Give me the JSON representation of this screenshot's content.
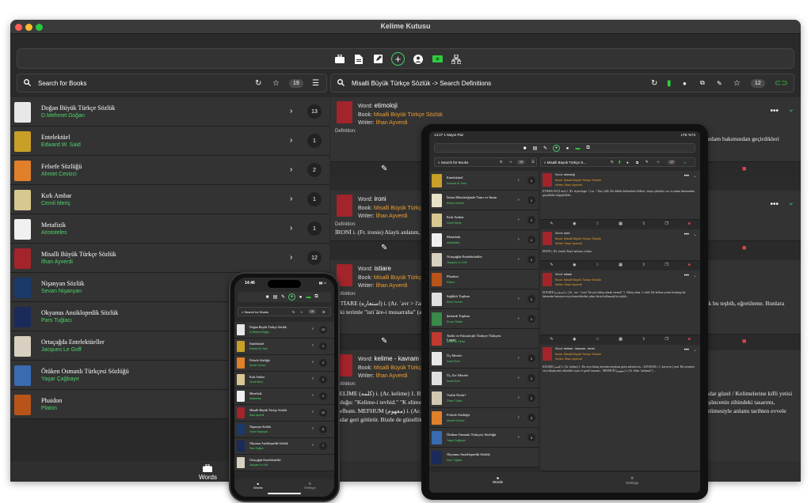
{
  "window": {
    "title": "Kelime Kutusu"
  },
  "left_search": {
    "placeholder": "Search for Books",
    "count": "19"
  },
  "right_search": {
    "query": "Misalli Büyük Türkçe Sözlük -> Search Definitions",
    "count": "12"
  },
  "books": [
    {
      "title": "Doğan Büyük Türkçe Sözlük",
      "author": "D.Mehmet Doğan",
      "count": "13",
      "color": "#e8e8e8"
    },
    {
      "title": "Entelektüel",
      "author": "Edward W. Said",
      "count": "1",
      "color": "#c8a028"
    },
    {
      "title": "Felsefe Sözlüğü",
      "author": "Ahmet Cevizci",
      "count": "2",
      "color": "#e0802a"
    },
    {
      "title": "Kırk Ambar",
      "author": "Cemil Meriç",
      "count": "1",
      "color": "#d8c890"
    },
    {
      "title": "Metafizik",
      "author": "Aristoteles",
      "count": "1",
      "color": "#f0f0f0"
    },
    {
      "title": "Misalli Büyük Türkçe Sözlük",
      "author": "İlhan Ayverdi",
      "count": "12",
      "color": "#a3242b"
    },
    {
      "title": "Nişanyan Sözlük",
      "author": "Sevan Nişanyan",
      "count": "",
      "color": "#1a3a6a"
    },
    {
      "title": "Okyanus Ansiklopedik Sözlük",
      "author": "Pars Tuğlacı",
      "count": "",
      "color": "#1a2a5a"
    },
    {
      "title": "Ortaçağda Entelektüeller",
      "author": "Jacques Le Goff",
      "count": "",
      "color": "#d8d0c0"
    },
    {
      "title": "Ötüken Osmanlı Türkçesi Sözlüğü",
      "author": "Yaşar Çağbayır",
      "count": "",
      "color": "#3a6ab0"
    },
    {
      "title": "Phaidon",
      "author": "Platon",
      "count": "",
      "color": "#b8541a"
    }
  ],
  "words": [
    {
      "word": "etimoloji",
      "book": "Misalli Büyük Türkçe Sözlük",
      "writer": "İlhan Ayverdi",
      "def_label": "Definition:",
      "text": "ETİMOLOJİ [İ ince] i. (Fr. etymologie < Lat. < Yun.) dilb. Bir dildeki kelimelerin kökleri, ortaya çıktıkları, ses ve anlam bakımından geçirdikleri değişikliklerini..."
    },
    {
      "word": "ironi",
      "book": "Misalli Büyük Türkçe Sözlük",
      "writer": "İlhan Ayverdi",
      "def_label": "Definition:",
      "text": "İRONİ i. (Fr. ironie) Alaylı anlatım, istihza."
    },
    {
      "word": "istiare",
      "book": "Misalli Büyük Türkçe Sözlük",
      "writer": "İlhan Ayverdi",
      "def_label": "Definition:",
      "text": "İSTİARE (استعاره) i. (Ar. ʿavr > i'are) 1. Ödünç alma. 2. edeb. Bir kelime yerine herhangi bir bakımdan benzeyen veya benzetilenden yalnız birini kullanarak bu teşbih, eğretileme. Bunlara eski terimle \"istiʿâre-i musarraha\" (açık istiare) denir."
    },
    {
      "word": "kelime - kavram - terim",
      "book": "Misalli Büyük Türkçe Sözlük",
      "writer": "İlhan Ayverdi",
      "def_label": "Definition:",
      "text": "KELİME (كلمه) i. (Ar. kelime) 1. Bir ses birliği veya bir kelime bile konuşamıyoruz (Reşat Nuri Güntekin). Kelimeler üzerinde düşünme bir şarkıların bu kadar güzel / Kelimelerine kifli yetisi olduğu: \"Kelime-i tevhid.\" \"K elime-i tayyibe.\" \"K elime-i şehadet.\" \"Tek kelimeyle: Sabır ve sebatla.\" KAVRAM i. (< kavra-m ) yeni. Bir nesnenin veya düşüncenin zihindeki tasarımı, mefhum. MEFHUM (مفهوم) i. (Ar. fehm \"anlamak\") Mefhum anlamları tarihten evvele kadar geri götürmek lazımdır (Refik H. Karay). Kavram, tasavvur kelimesiyle anlamı tarihten evvele kadar geri götürür. Bizde de güzellik mefhumu ... \"Devlet mefhumu.\" \"Adalet mefhumu.\""
    }
  ],
  "labels": {
    "book": "Book:",
    "writer": "Writer:",
    "word": "Word:"
  },
  "tabs": {
    "words": "Words",
    "settings": "Settings"
  },
  "ipad": {
    "status_left": "14:27  1 Mayıs Paz",
    "status_right": "LTE %74",
    "search_left": "Search for Books",
    "search_right": "Misalli Büyük Türkçe S...",
    "left_count": "19",
    "right_count": "12",
    "books": [
      {
        "title": "Entelektüel",
        "author": "Edward W. Said",
        "count": "1",
        "color": "#c8a028"
      },
      {
        "title": "İslam Metafiziğinde Tanrı ve İnsan",
        "author": "Ekrem Demirli",
        "count": "1",
        "color": "#e8e0c8"
      },
      {
        "title": "Kırk Ambar",
        "author": "Cemil Meriç",
        "count": "1",
        "color": "#d8c890"
      },
      {
        "title": "Metafizik",
        "author": "Aristoteles",
        "count": "1",
        "color": "#f0f0f0"
      },
      {
        "title": "Ortaçağda Entelektüeller",
        "author": "Jacques Le Goff",
        "count": "1",
        "color": "#d8d0c0"
      },
      {
        "title": "Phaidon",
        "author": "Platon",
        "count": "",
        "color": "#b8541a"
      },
      {
        "title": "Sağlıklı Toplum",
        "author": "Erich Fromm",
        "count": "1",
        "color": "#e0e0e0"
      },
      {
        "title": "Şeriatik Toplum",
        "author": "Ercan Öksüz",
        "count": "1",
        "color": "#3a8a4a"
      },
      {
        "title": "Tarihi ve Etimolojik Türkiye Türkçesi Lugati",
        "author": "Andreas Tietze",
        "count": "",
        "color": "#c03a30"
      },
      {
        "title": "Üç Mesele",
        "author": "İsmet Özel",
        "count": "1",
        "color": "#e8e8e8"
      },
      {
        "title": "Üç Zor Mesele",
        "author": "İsmet Özel",
        "count": "1",
        "color": "#e0e0e0"
      },
      {
        "title": "Varlık Nedir?",
        "author": "Ömer Türker",
        "count": "1",
        "color": "#d0c8b0"
      },
      {
        "title": "Felsefe Sözlüğü",
        "author": "Ahmet Cevizci",
        "count": "2",
        "color": "#e0802a"
      },
      {
        "title": "Ötüken Osmanlı Türkçesi Sözlüğü",
        "author": "Yaşar Çağbayır",
        "count": "3",
        "color": "#3a6ab0"
      },
      {
        "title": "Okyanus Ansiklopedik Sözlük",
        "author": "Pars Tuğlacı",
        "count": "",
        "color": "#1a2a5a"
      }
    ],
    "words": [
      {
        "word": "etimoloji",
        "text": "ETİMOLOJİ [İ ince] i. (Fr. etymologie < Lat. < Yun.) dilb. Bir dildeki kelimelerin kökleri, ortaya çıktıkları, ses ve anlam bakımından geçirdikleri değişiklikler..."
      },
      {
        "word": "ironi",
        "text": "İRONİ i. (Fr. ironie) Alaylı anlatım, istihza."
      },
      {
        "word": "istiare",
        "text": "İSTİARE (استعاره) i. (Ar. ʿavr > i'are) \"bir şeyi ödünç alarak vermek\" 1. Ödünç alma. 2. edeb. Bir kelime yerine herhangi bir bakımdan benzeyen veya benzetilenden yalnız birini kullanarak bu teşbih..."
      },
      {
        "word": "kelime - kavram - terim",
        "text": "KELİME (كلمه) i. (Ar. kelime) 1. Bir veya birkaç heceden meydana gelen anlamlı ses... KAVRAM i. (< kavra-m ) yeni. Bir nesnenin veya düşüncenin zihindeki soyut ve genel tasarımı... MEFHUM (مفهوم) i. (Ar. fehm \"anlamak\") ..."
      }
    ]
  },
  "iphone": {
    "time": "14:46",
    "search": "Search for Books",
    "count": "19",
    "books": [
      {
        "title": "Doğan Büyük Türkçe Sözlük",
        "author": "D.Mehmet Doğan",
        "count": "13",
        "color": "#e8e8e8"
      },
      {
        "title": "Entelektüel",
        "author": "Edward W. Said",
        "count": "1",
        "color": "#c8a028"
      },
      {
        "title": "Felsefe Sözlüğü",
        "author": "Ahmet Cevizci",
        "count": "2",
        "color": "#e0802a"
      },
      {
        "title": "Kırk Ambar",
        "author": "Cemil Meriç",
        "count": "1",
        "color": "#d8c890"
      },
      {
        "title": "Metafizik",
        "author": "Aristoteles",
        "count": "1",
        "color": "#f0f0f0"
      },
      {
        "title": "Misalli Büyük Türkçe Sözlük",
        "author": "İlhan Ayverdi",
        "count": "12",
        "color": "#a3242b"
      },
      {
        "title": "Nişanyan Sözlük",
        "author": "Sevan Nişanyan",
        "count": "6",
        "color": "#1a3a6a"
      },
      {
        "title": "Okyanus Ansiklopedik Sözlük",
        "author": "Pars Tuğlacı",
        "count": "7",
        "color": "#1a2a5a"
      },
      {
        "title": "Ortaçağda Entelektüeller",
        "author": "Jacques Le Goff",
        "count": "",
        "color": "#d8d0c0"
      }
    ]
  }
}
